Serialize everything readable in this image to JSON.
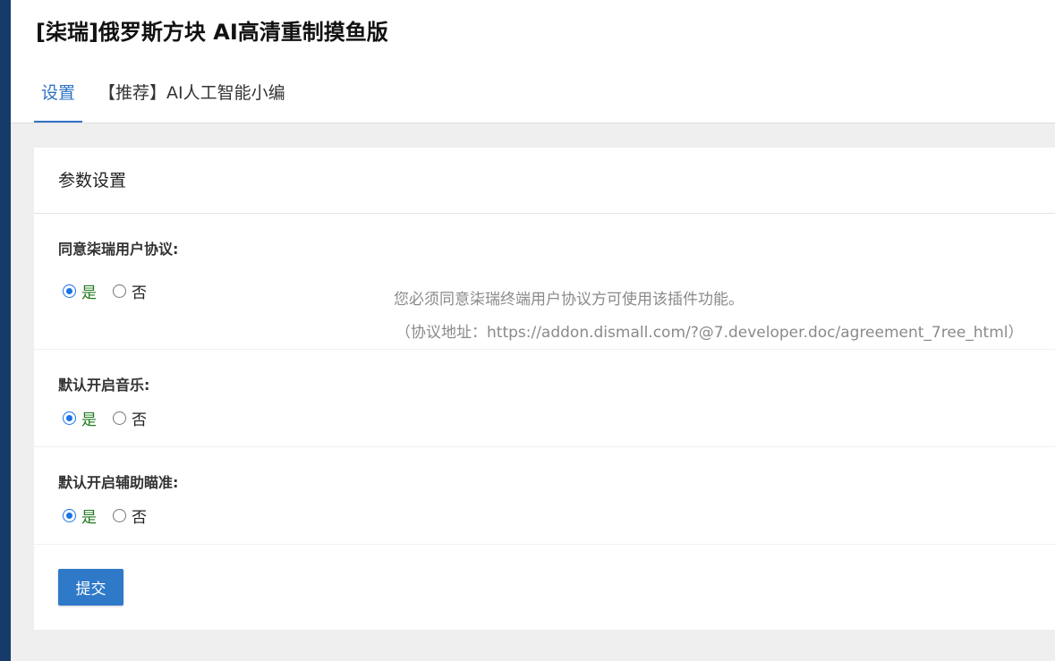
{
  "header": {
    "title": "[柒瑞]俄罗斯方块 AI高清重制摸鱼版",
    "tabs": [
      {
        "label": "设置",
        "active": true
      },
      {
        "label": "【推荐】AI人工智能小编",
        "active": false
      }
    ]
  },
  "card": {
    "title": "参数设置",
    "fields": [
      {
        "label": "同意柒瑞用户协议:",
        "options": {
          "yes": "是",
          "no": "否"
        },
        "selected": "yes",
        "hint_line1": "您必须同意柒瑞终端用户协议方可使用该插件功能。",
        "hint_line2": "（协议地址：https://addon.dismall.com/?@7.developer.doc/agreement_7ree_html）"
      },
      {
        "label": "默认开启音乐:",
        "options": {
          "yes": "是",
          "no": "否"
        },
        "selected": "yes"
      },
      {
        "label": "默认开启辅助瞄准:",
        "options": {
          "yes": "是",
          "no": "否"
        },
        "selected": "yes"
      }
    ],
    "submit_label": "提交"
  },
  "colors": {
    "left_bar": "#163b6b",
    "accent": "#2e72c4",
    "submit_bg": "#2f79c9",
    "yes_text": "#1f7a1f"
  }
}
